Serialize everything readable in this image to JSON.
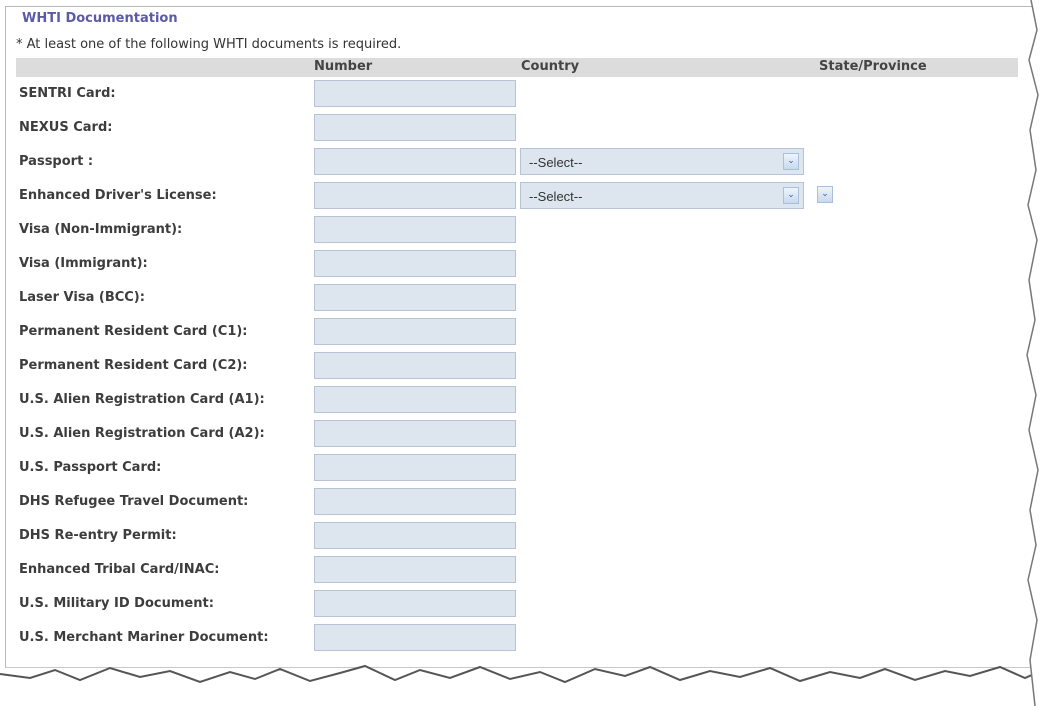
{
  "section": {
    "title": "WHTI Documentation",
    "note": "* At least one of the following WHTI documents is required."
  },
  "columns": {
    "number": "Number",
    "country": "Country",
    "state": "State/Province"
  },
  "rows": [
    {
      "label": "SENTRI Card:"
    },
    {
      "label": "NEXUS Card:"
    },
    {
      "label": "Passport :",
      "country": "--Select--"
    },
    {
      "label": "Enhanced Driver's License:",
      "country": "--Select--"
    },
    {
      "label": "Visa (Non-Immigrant):"
    },
    {
      "label": "Visa (Immigrant):"
    },
    {
      "label": "Laser Visa (BCC):"
    },
    {
      "label": "Permanent Resident Card (C1):"
    },
    {
      "label": "Permanent Resident Card (C2):"
    },
    {
      "label": "U.S. Alien Registration Card (A1):"
    },
    {
      "label": "U.S. Alien Registration Card (A2):"
    },
    {
      "label": "U.S. Passport Card:"
    },
    {
      "label": "DHS Refugee Travel Document:"
    },
    {
      "label": "DHS Re-entry Permit:"
    },
    {
      "label": "Enhanced Tribal Card/INAC:"
    },
    {
      "label": "U.S. Military ID Document:"
    },
    {
      "label": "U.S. Merchant Mariner Document:"
    }
  ],
  "colors": {
    "title": "#5a5aa8",
    "field_bg": "#dde5ee",
    "header_bg": "#dcdcdc"
  }
}
